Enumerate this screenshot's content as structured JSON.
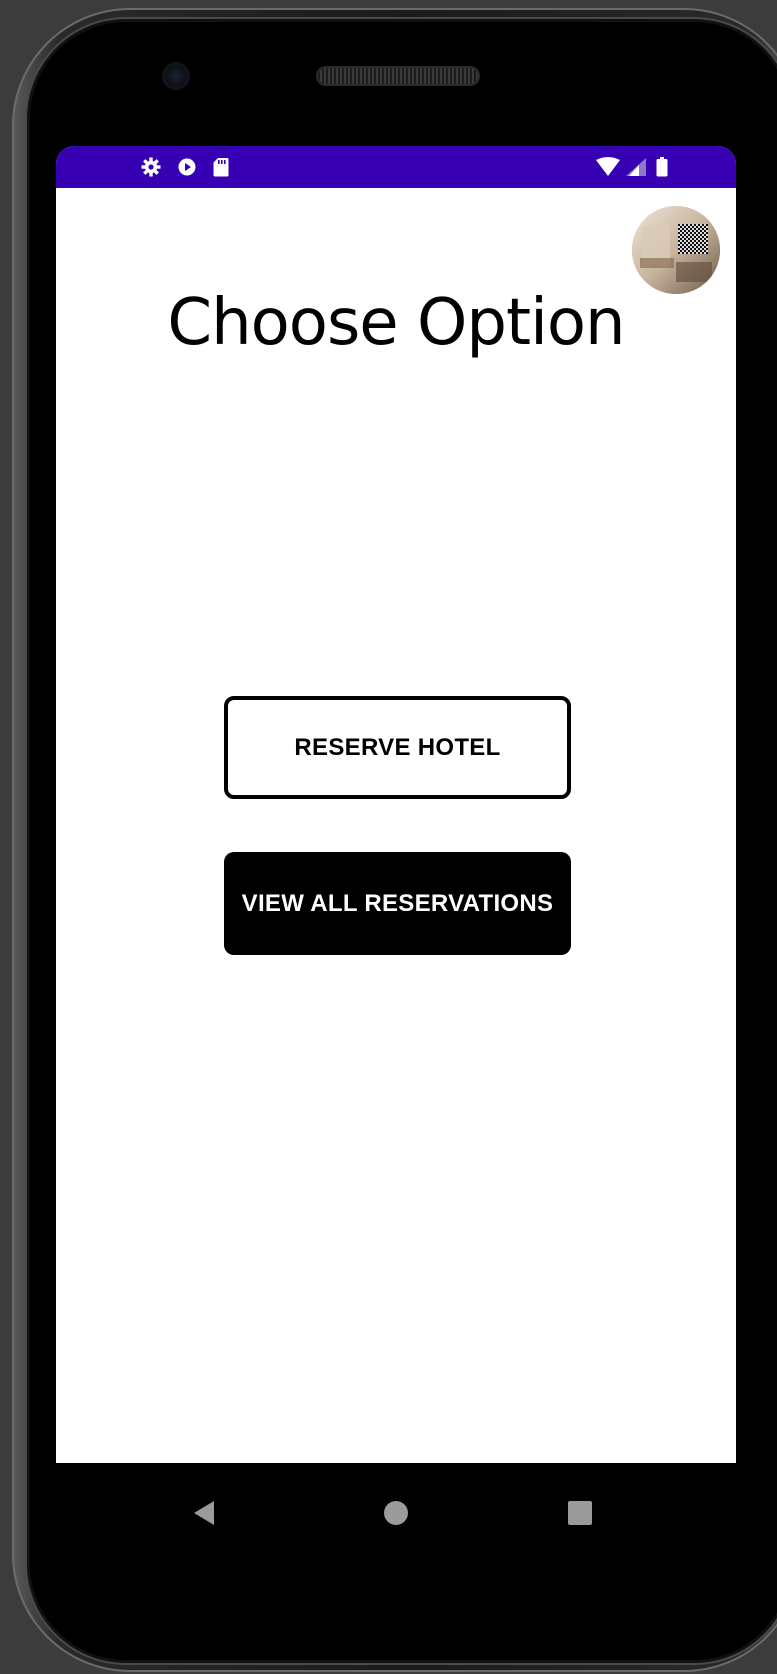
{
  "status_bar": {
    "background": "#3700b3",
    "left_icons": [
      "settings-gear-icon",
      "play-protect-icon",
      "sd-card-icon"
    ],
    "right_icons": [
      "wifi-icon",
      "cell-signal-icon",
      "battery-icon"
    ]
  },
  "header": {
    "title": "Choose Option"
  },
  "actions": {
    "reserve_label": "RESERVE HOTEL",
    "view_label": "VIEW ALL RESERVATIONS"
  },
  "nav_bar": {
    "icons": [
      "back-triangle-icon",
      "home-circle-icon",
      "recents-square-icon"
    ]
  },
  "colors": {
    "accent": "#3700b3",
    "button_dark": "#000000",
    "button_text_light": "#ffffff"
  }
}
